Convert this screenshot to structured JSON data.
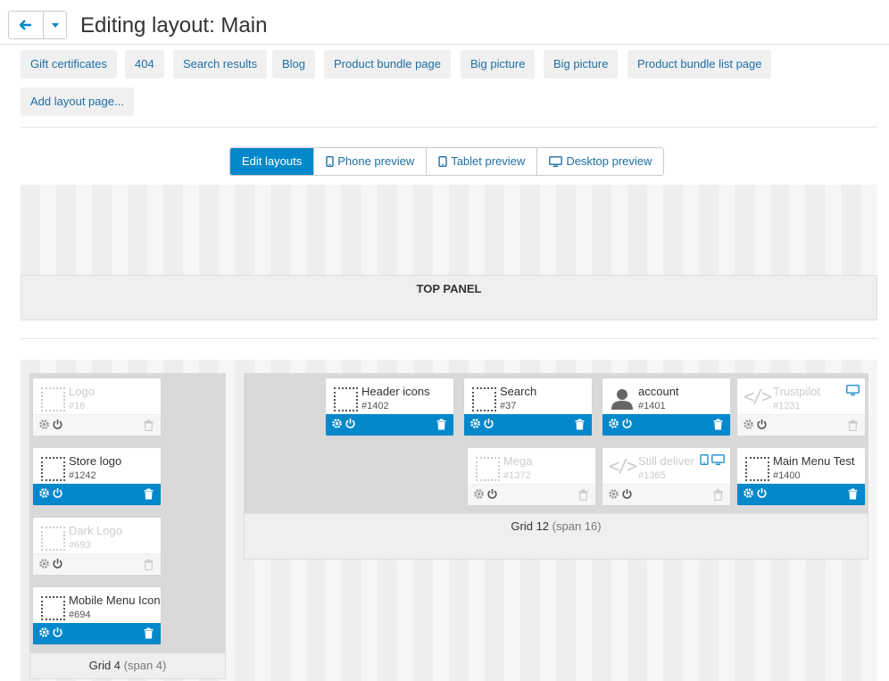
{
  "header": {
    "title": "Editing layout: Main"
  },
  "layout_pages": [
    {
      "label": "Gift certificates"
    },
    {
      "label": "404"
    },
    {
      "label": "Search results"
    },
    {
      "label": "Blog"
    },
    {
      "label": "Product bundle page"
    },
    {
      "label": "Big picture"
    },
    {
      "label": "Big picture"
    },
    {
      "label": "Product bundle list page"
    }
  ],
  "add_layout_page": "Add layout page...",
  "modes": {
    "edit": "Edit layouts",
    "phone": "Phone preview",
    "tablet": "Tablet preview",
    "desktop": "Desktop preview",
    "active": "edit"
  },
  "top_panel": {
    "label": "TOP PANEL"
  },
  "grids": {
    "grid4": {
      "name": "Grid 4",
      "span": "(span 4)",
      "blocks": [
        {
          "name": "Logo",
          "id": "#16",
          "enabled": false
        },
        {
          "name": "Store logo",
          "id": "#1242",
          "enabled": true
        },
        {
          "name": "Dark Logo",
          "id": "#693",
          "enabled": false
        },
        {
          "name": "Mobile Menu Icon",
          "id": "#694",
          "enabled": true
        }
      ]
    },
    "grid12": {
      "name": "Grid 12",
      "span": "(span 16)",
      "blocks": [
        {
          "name": "Header icons",
          "id": "#1402",
          "enabled": true,
          "icon": "dotted-box-icon"
        },
        {
          "name": "Search",
          "id": "#37",
          "enabled": true,
          "icon": "dotted-box-icon"
        },
        {
          "name": "account",
          "id": "#1401",
          "enabled": true,
          "icon": "user-icon"
        },
        {
          "name": "Trustpilot",
          "id": "#1231",
          "enabled": false,
          "icon": "code-icon"
        },
        {
          "name": "Mega",
          "id": "#1372",
          "enabled": false,
          "icon": "dotted-box-icon"
        },
        {
          "name": "Still deliver",
          "id": "#1365",
          "enabled": false,
          "icon": "code-icon"
        },
        {
          "name": "Main Menu Test",
          "id": "#1400",
          "enabled": true,
          "icon": "dotted-box-icon"
        }
      ]
    }
  },
  "colors": {
    "accent": "#0388cc",
    "link": "#1d6fa5"
  }
}
